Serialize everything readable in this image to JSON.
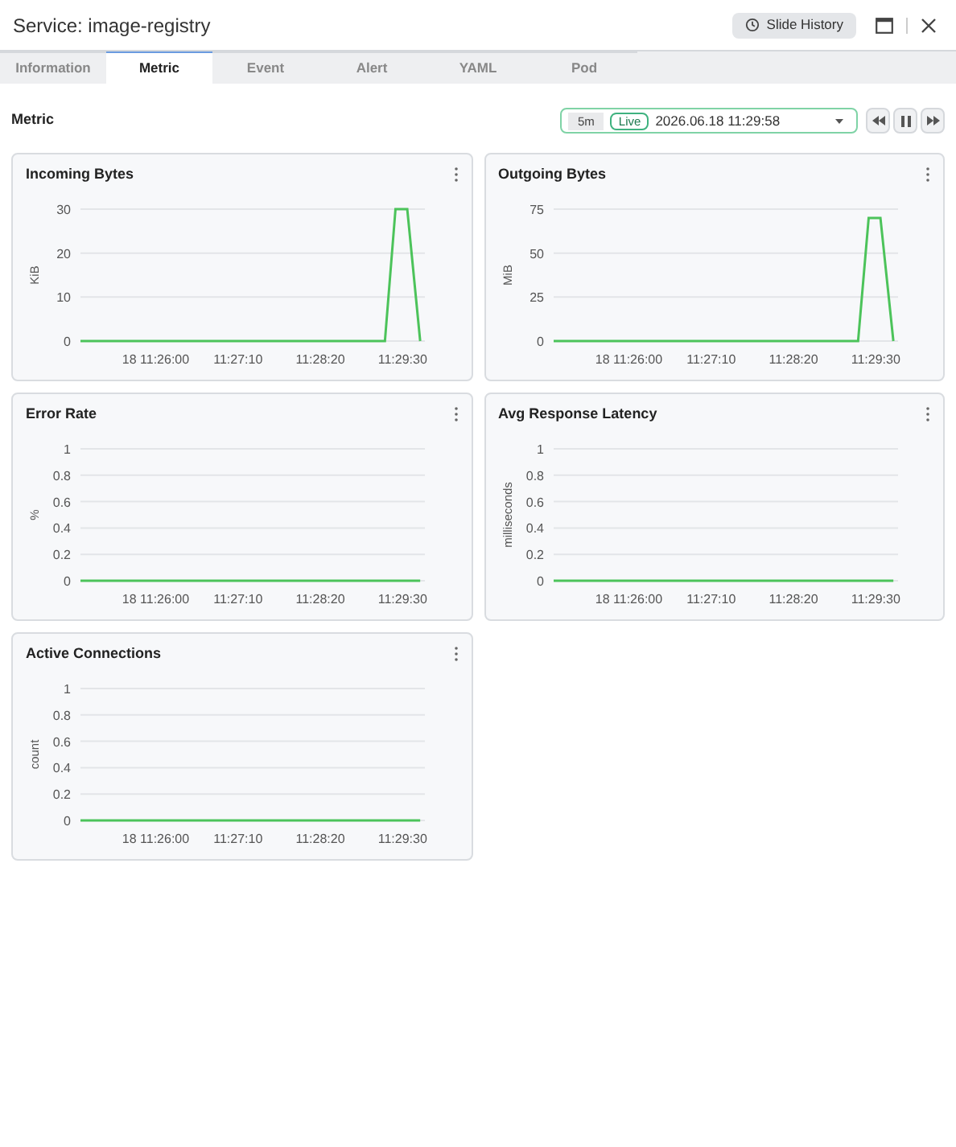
{
  "window": {
    "title": "Service: image-registry",
    "slide_history_button": "Slide History"
  },
  "tabs": [
    {
      "label": "Information",
      "selected": false
    },
    {
      "label": "Metric",
      "selected": true
    },
    {
      "label": "Event",
      "selected": false
    },
    {
      "label": "Alert",
      "selected": false
    },
    {
      "label": "YAML",
      "selected": false
    },
    {
      "label": "Pod",
      "selected": false
    }
  ],
  "metric_section": {
    "title": "Metric",
    "range": "5m",
    "live_badge": "Live",
    "time_field": "2026.06.18 11:29:58"
  },
  "panels": [
    {
      "title": "Incoming Bytes",
      "chart_data": {
        "type": "line",
        "grid": true,
        "ylabel": "KiB",
        "x": [
          41096,
          41355,
          41364,
          41374,
          41385
        ],
        "series": [
          {
            "color": "#4cc35a",
            "values": [
              0,
              0,
              30,
              30,
              0
            ]
          }
        ],
        "xlim": [
          41096,
          41389
        ],
        "ylim": [
          0,
          30
        ],
        "xticks": [
          {
            "value": 41160,
            "label": "18 11:26:00"
          },
          {
            "value": 41230,
            "label": "11:27:10"
          },
          {
            "value": 41300,
            "label": "11:28:20"
          },
          {
            "value": 41370,
            "label": "11:29:30"
          }
        ],
        "yticks": [
          0,
          10,
          20,
          30
        ]
      }
    },
    {
      "title": "Outgoing Bytes",
      "chart_data": {
        "type": "line",
        "grid": true,
        "ylabel": "MiB",
        "x": [
          41096,
          41355,
          41364,
          41374,
          41385
        ],
        "series": [
          {
            "color": "#4cc35a",
            "values": [
              0,
              0,
              70,
              70,
              0
            ]
          }
        ],
        "xlim": [
          41096,
          41389
        ],
        "ylim": [
          0,
          75
        ],
        "xticks": [
          {
            "value": 41160,
            "label": "18 11:26:00"
          },
          {
            "value": 41230,
            "label": "11:27:10"
          },
          {
            "value": 41300,
            "label": "11:28:20"
          },
          {
            "value": 41370,
            "label": "11:29:30"
          }
        ],
        "yticks": [
          0,
          25,
          50,
          75
        ]
      }
    },
    {
      "title": "Error Rate",
      "chart_data": {
        "type": "line",
        "grid": true,
        "ylabel": "%",
        "x": [
          41096,
          41385
        ],
        "series": [
          {
            "color": "#4cc35a",
            "values": [
              0,
              0
            ]
          }
        ],
        "xlim": [
          41096,
          41389
        ],
        "ylim": [
          0,
          1
        ],
        "xticks": [
          {
            "value": 41160,
            "label": "18 11:26:00"
          },
          {
            "value": 41230,
            "label": "11:27:10"
          },
          {
            "value": 41300,
            "label": "11:28:20"
          },
          {
            "value": 41370,
            "label": "11:29:30"
          }
        ],
        "yticks": [
          0,
          0.2,
          0.4,
          0.6,
          0.8,
          1
        ]
      }
    },
    {
      "title": "Avg Response Latency",
      "chart_data": {
        "type": "line",
        "grid": true,
        "ylabel": "milliseconds",
        "x": [
          41096,
          41385
        ],
        "series": [
          {
            "color": "#4cc35a",
            "values": [
              0,
              0
            ]
          }
        ],
        "xlim": [
          41096,
          41389
        ],
        "ylim": [
          0,
          1
        ],
        "xticks": [
          {
            "value": 41160,
            "label": "18 11:26:00"
          },
          {
            "value": 41230,
            "label": "11:27:10"
          },
          {
            "value": 41300,
            "label": "11:28:20"
          },
          {
            "value": 41370,
            "label": "11:29:30"
          }
        ],
        "yticks": [
          0,
          0.2,
          0.4,
          0.6,
          0.8,
          1
        ]
      }
    },
    {
      "title": "Active Connections",
      "chart_data": {
        "type": "line",
        "grid": true,
        "ylabel": "count",
        "x": [
          41096,
          41385
        ],
        "series": [
          {
            "color": "#4cc35a",
            "values": [
              0,
              0
            ]
          }
        ],
        "xlim": [
          41096,
          41389
        ],
        "ylim": [
          0,
          1
        ],
        "xticks": [
          {
            "value": 41160,
            "label": "18 11:26:00"
          },
          {
            "value": 41230,
            "label": "11:27:10"
          },
          {
            "value": 41300,
            "label": "11:28:20"
          },
          {
            "value": 41370,
            "label": "11:29:30"
          }
        ],
        "yticks": [
          0,
          0.2,
          0.4,
          0.6,
          0.8,
          1
        ]
      }
    }
  ]
}
